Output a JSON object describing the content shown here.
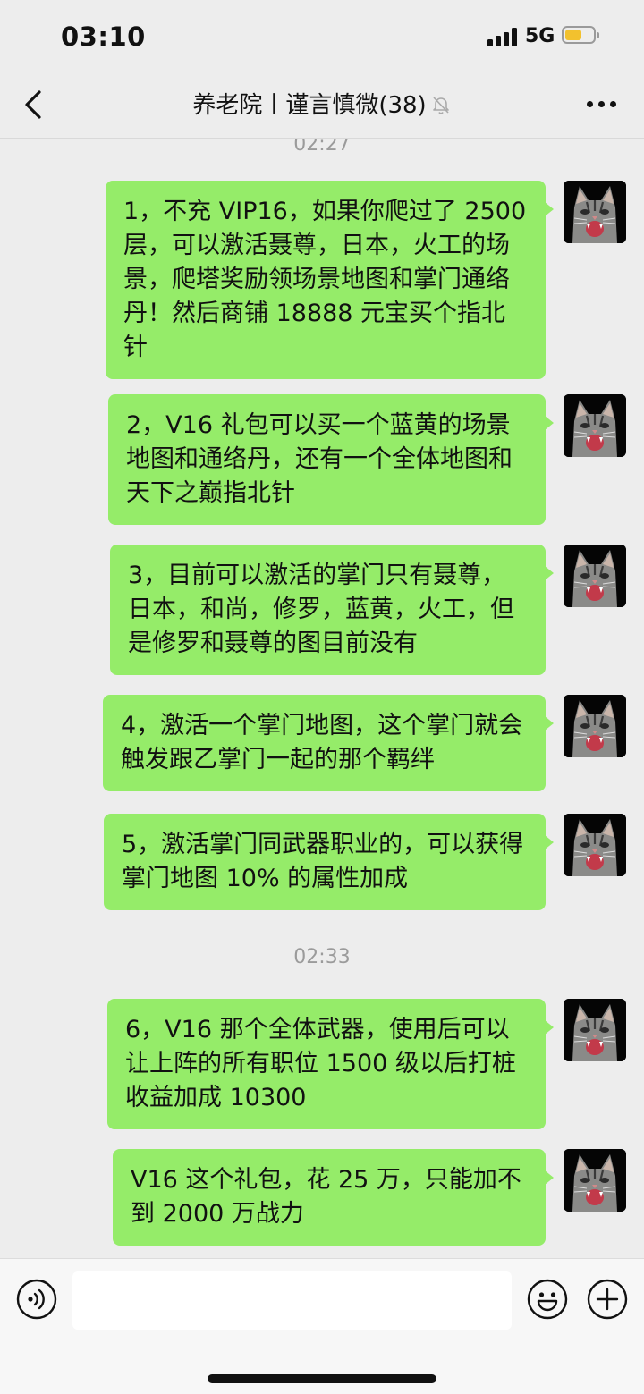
{
  "status_bar": {
    "time": "03:10",
    "network": "5G",
    "battery_level": 0.6
  },
  "nav": {
    "title": "养老院丨谨言慎微(38)",
    "muted": true
  },
  "chat": {
    "items": [
      {
        "type": "time",
        "text": "02:27"
      },
      {
        "type": "msg",
        "text": "1，不充 VIP16，如果你爬过了 2500 层，可以激活聂尊，日本，火工的场景，爬塔奖励领场景地图和掌门通络丹！然后商铺 18888 元宝买个指北针"
      },
      {
        "type": "msg",
        "text": "2，V16 礼包可以买一个蓝黄的场景地图和通络丹，还有一个全体地图和天下之巅指北针"
      },
      {
        "type": "msg",
        "text": "3，目前可以激活的掌门只有聂尊，日本，和尚，修罗，蓝黄，火工，但是修罗和聂尊的图目前没有"
      },
      {
        "type": "msg",
        "text": "4，激活一个掌门地图，这个掌门就会触发跟乙掌门一起的那个羁绊"
      },
      {
        "type": "msg",
        "text": "5，激活掌门同武器职业的，可以获得掌门地图 10% 的属性加成"
      },
      {
        "type": "time",
        "text": "02:33"
      },
      {
        "type": "msg",
        "text": "6，V16 那个全体武器，使用后可以让上阵的所有职位 1500 级以后打桩收益加成 10300"
      },
      {
        "type": "msg",
        "text": "V16 这个礼包，花 25 万，只能加不到 2000 万战力"
      }
    ]
  },
  "colors": {
    "bubble": "#95ec69",
    "background": "#ededed"
  },
  "icons": [
    "back-icon",
    "mute-bell-icon",
    "more-icon",
    "voice-icon",
    "emoji-icon",
    "plus-icon"
  ]
}
